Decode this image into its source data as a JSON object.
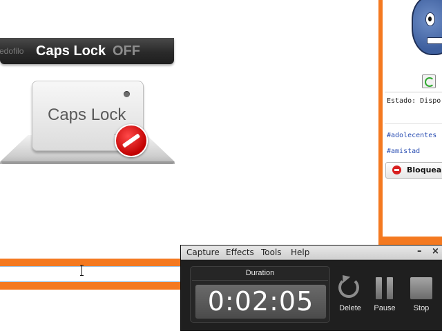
{
  "caps_lock_osd": {
    "ghost_text": "edofilo",
    "title_on": "Caps Lock",
    "state": "OFF",
    "key_label": "Caps Lock"
  },
  "profile_panel": {
    "status_text": "Estado: Dispo",
    "tags": [
      "#adolecentes",
      "#amistad"
    ],
    "block_label": "Bloquear"
  },
  "recorder": {
    "menu": [
      "Capture",
      "Effects",
      "Tools",
      "Help"
    ],
    "window_buttons": {
      "minimize": "–",
      "close": "×"
    },
    "duration_label": "Duration",
    "duration_value": "0:02:05",
    "controls": {
      "delete": "Delete",
      "pause": "Pause",
      "stop": "Stop"
    }
  },
  "colors": {
    "accent_orange": "#f47920",
    "osd_dark": "#2a2a2a",
    "block_red": "#d81f1f",
    "link_blue": "#2b4fb3"
  }
}
